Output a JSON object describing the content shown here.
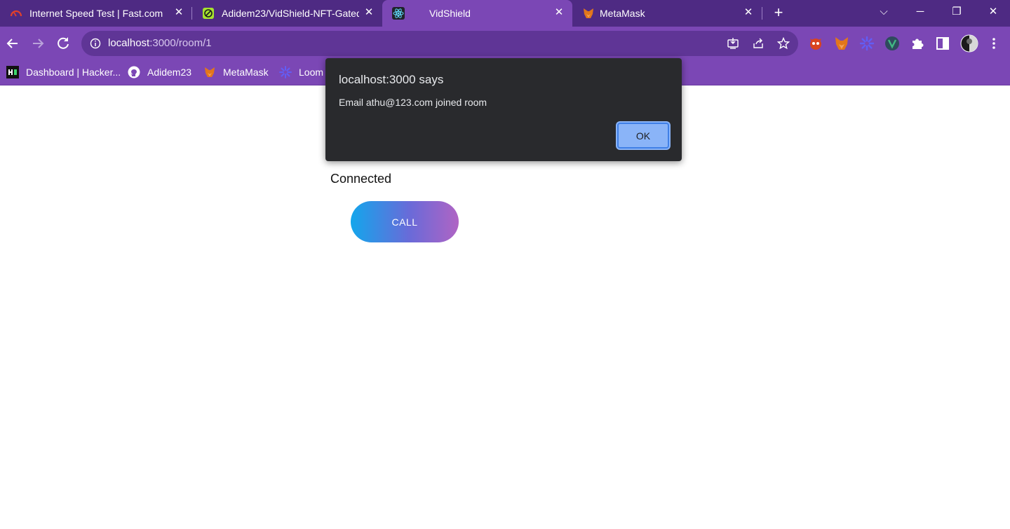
{
  "tabs": [
    {
      "label": "Internet Speed Test | Fast.com",
      "icon": "speedometer-icon",
      "active": false
    },
    {
      "label": "Adidem23/VidShield-NFT-Gated-",
      "icon": "github-repo-icon",
      "active": false
    },
    {
      "label": "VidShield",
      "icon": "react-icon",
      "active": true
    },
    {
      "label": "MetaMask",
      "icon": "metamask-fox-icon",
      "active": false
    }
  ],
  "tab_close_glyph": "✕",
  "new_tab_glyph": "+",
  "window_controls": {
    "tab_search": "⌵",
    "minimize": "─",
    "restore": "❐",
    "close": "✕"
  },
  "address_bar": {
    "host": "localhost",
    "path": ":3000/room/1"
  },
  "bookmarks": [
    {
      "label": "Dashboard | Hacker...",
      "icon": "hackerearth-icon"
    },
    {
      "label": "Adidem23",
      "icon": "github-icon"
    },
    {
      "label": "MetaMask",
      "icon": "metamask-fox-icon"
    },
    {
      "label": "Loom",
      "icon": "loom-icon"
    }
  ],
  "page": {
    "status": "Connected",
    "call_button": "CALL"
  },
  "dialog": {
    "title": "localhost:3000 says",
    "message": "Email athu@123.com joined room",
    "ok_button": "OK"
  },
  "colors": {
    "tab_strip": "#4e2a83",
    "toolbar": "#7b47b5",
    "dialog_bg": "#292a2d",
    "dialog_ok": "#8ab4f8",
    "call_gradient_start": "#13a6ec",
    "call_gradient_end": "#b064c4"
  }
}
